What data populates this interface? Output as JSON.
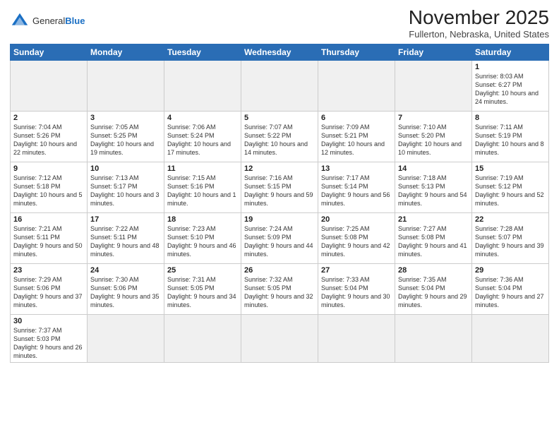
{
  "header": {
    "logo_general": "General",
    "logo_blue": "Blue",
    "month_title": "November 2025",
    "location": "Fullerton, Nebraska, United States"
  },
  "days_of_week": [
    "Sunday",
    "Monday",
    "Tuesday",
    "Wednesday",
    "Thursday",
    "Friday",
    "Saturday"
  ],
  "weeks": [
    [
      {
        "day": "",
        "info": "",
        "empty": true
      },
      {
        "day": "",
        "info": "",
        "empty": true
      },
      {
        "day": "",
        "info": "",
        "empty": true
      },
      {
        "day": "",
        "info": "",
        "empty": true
      },
      {
        "day": "",
        "info": "",
        "empty": true
      },
      {
        "day": "",
        "info": "",
        "empty": true
      },
      {
        "day": "1",
        "info": "Sunrise: 8:03 AM\nSunset: 6:27 PM\nDaylight: 10 hours and 24 minutes."
      }
    ],
    [
      {
        "day": "2",
        "info": "Sunrise: 7:04 AM\nSunset: 5:26 PM\nDaylight: 10 hours and 22 minutes."
      },
      {
        "day": "3",
        "info": "Sunrise: 7:05 AM\nSunset: 5:25 PM\nDaylight: 10 hours and 19 minutes."
      },
      {
        "day": "4",
        "info": "Sunrise: 7:06 AM\nSunset: 5:24 PM\nDaylight: 10 hours and 17 minutes."
      },
      {
        "day": "5",
        "info": "Sunrise: 7:07 AM\nSunset: 5:22 PM\nDaylight: 10 hours and 14 minutes."
      },
      {
        "day": "6",
        "info": "Sunrise: 7:09 AM\nSunset: 5:21 PM\nDaylight: 10 hours and 12 minutes."
      },
      {
        "day": "7",
        "info": "Sunrise: 7:10 AM\nSunset: 5:20 PM\nDaylight: 10 hours and 10 minutes."
      },
      {
        "day": "8",
        "info": "Sunrise: 7:11 AM\nSunset: 5:19 PM\nDaylight: 10 hours and 8 minutes."
      }
    ],
    [
      {
        "day": "9",
        "info": "Sunrise: 7:12 AM\nSunset: 5:18 PM\nDaylight: 10 hours and 5 minutes."
      },
      {
        "day": "10",
        "info": "Sunrise: 7:13 AM\nSunset: 5:17 PM\nDaylight: 10 hours and 3 minutes."
      },
      {
        "day": "11",
        "info": "Sunrise: 7:15 AM\nSunset: 5:16 PM\nDaylight: 10 hours and 1 minute."
      },
      {
        "day": "12",
        "info": "Sunrise: 7:16 AM\nSunset: 5:15 PM\nDaylight: 9 hours and 59 minutes."
      },
      {
        "day": "13",
        "info": "Sunrise: 7:17 AM\nSunset: 5:14 PM\nDaylight: 9 hours and 56 minutes."
      },
      {
        "day": "14",
        "info": "Sunrise: 7:18 AM\nSunset: 5:13 PM\nDaylight: 9 hours and 54 minutes."
      },
      {
        "day": "15",
        "info": "Sunrise: 7:19 AM\nSunset: 5:12 PM\nDaylight: 9 hours and 52 minutes."
      }
    ],
    [
      {
        "day": "16",
        "info": "Sunrise: 7:21 AM\nSunset: 5:11 PM\nDaylight: 9 hours and 50 minutes."
      },
      {
        "day": "17",
        "info": "Sunrise: 7:22 AM\nSunset: 5:11 PM\nDaylight: 9 hours and 48 minutes."
      },
      {
        "day": "18",
        "info": "Sunrise: 7:23 AM\nSunset: 5:10 PM\nDaylight: 9 hours and 46 minutes."
      },
      {
        "day": "19",
        "info": "Sunrise: 7:24 AM\nSunset: 5:09 PM\nDaylight: 9 hours and 44 minutes."
      },
      {
        "day": "20",
        "info": "Sunrise: 7:25 AM\nSunset: 5:08 PM\nDaylight: 9 hours and 42 minutes."
      },
      {
        "day": "21",
        "info": "Sunrise: 7:27 AM\nSunset: 5:08 PM\nDaylight: 9 hours and 41 minutes."
      },
      {
        "day": "22",
        "info": "Sunrise: 7:28 AM\nSunset: 5:07 PM\nDaylight: 9 hours and 39 minutes."
      }
    ],
    [
      {
        "day": "23",
        "info": "Sunrise: 7:29 AM\nSunset: 5:06 PM\nDaylight: 9 hours and 37 minutes."
      },
      {
        "day": "24",
        "info": "Sunrise: 7:30 AM\nSunset: 5:06 PM\nDaylight: 9 hours and 35 minutes."
      },
      {
        "day": "25",
        "info": "Sunrise: 7:31 AM\nSunset: 5:05 PM\nDaylight: 9 hours and 34 minutes."
      },
      {
        "day": "26",
        "info": "Sunrise: 7:32 AM\nSunset: 5:05 PM\nDaylight: 9 hours and 32 minutes."
      },
      {
        "day": "27",
        "info": "Sunrise: 7:33 AM\nSunset: 5:04 PM\nDaylight: 9 hours and 30 minutes."
      },
      {
        "day": "28",
        "info": "Sunrise: 7:35 AM\nSunset: 5:04 PM\nDaylight: 9 hours and 29 minutes."
      },
      {
        "day": "29",
        "info": "Sunrise: 7:36 AM\nSunset: 5:04 PM\nDaylight: 9 hours and 27 minutes."
      }
    ],
    [
      {
        "day": "30",
        "info": "Sunrise: 7:37 AM\nSunset: 5:03 PM\nDaylight: 9 hours and 26 minutes."
      },
      {
        "day": "",
        "info": "",
        "empty": true
      },
      {
        "day": "",
        "info": "",
        "empty": true
      },
      {
        "day": "",
        "info": "",
        "empty": true
      },
      {
        "day": "",
        "info": "",
        "empty": true
      },
      {
        "day": "",
        "info": "",
        "empty": true
      },
      {
        "day": "",
        "info": "",
        "empty": true
      }
    ]
  ]
}
